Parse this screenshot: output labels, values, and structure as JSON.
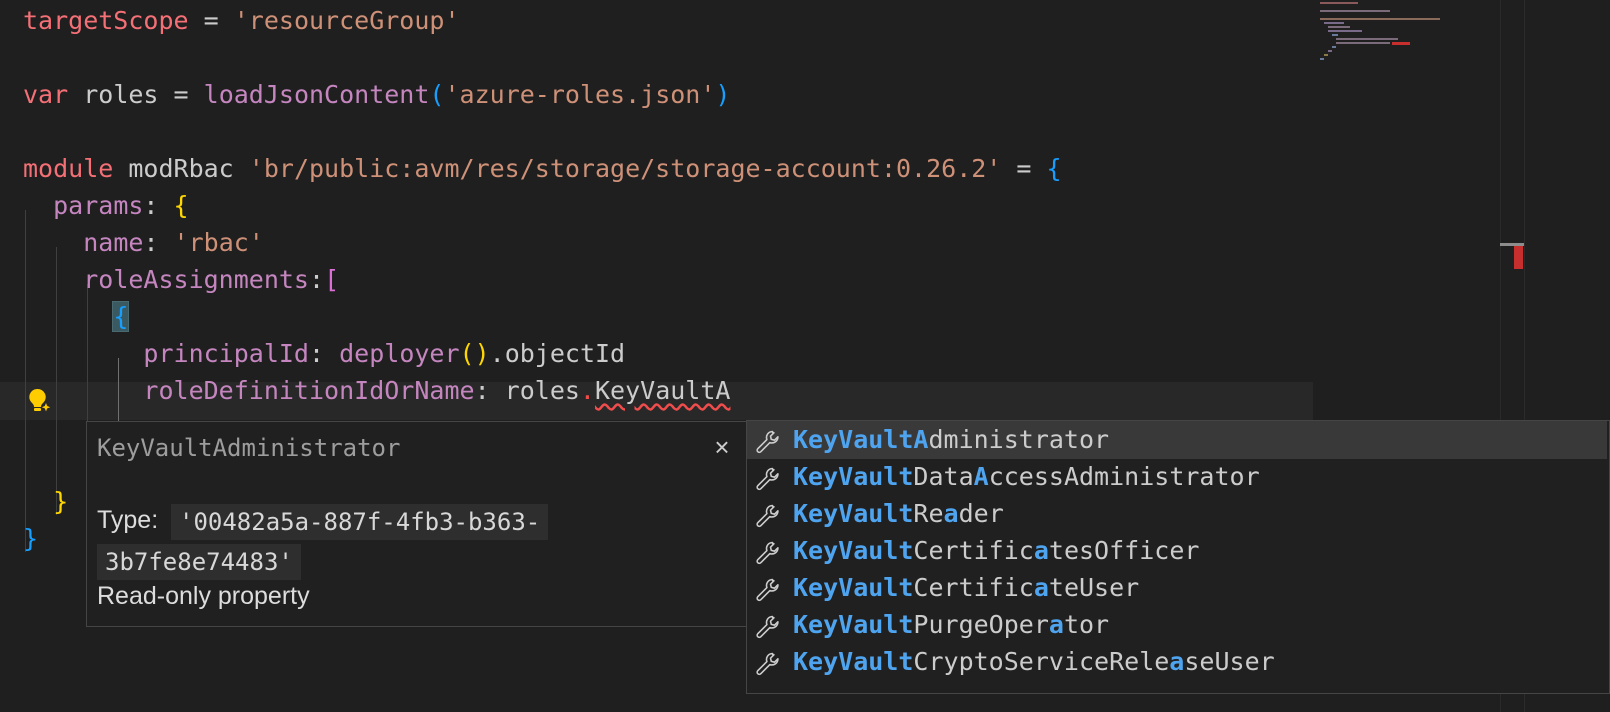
{
  "code_lines": [
    {
      "row": 0,
      "tokens": [
        [
          "kw",
          "targetScope"
        ],
        [
          "punc",
          " = "
        ],
        [
          "str",
          "'resourceGroup'"
        ]
      ]
    },
    {
      "row": 2,
      "tokens": [
        [
          "kw",
          "var"
        ],
        [
          "punc",
          " "
        ],
        [
          "ident",
          "roles"
        ],
        [
          "punc",
          " = "
        ],
        [
          "fn",
          "loadJsonContent"
        ],
        [
          "b3",
          "("
        ],
        [
          "str",
          "'azure-roles.json'"
        ],
        [
          "b3",
          ")"
        ]
      ]
    },
    {
      "row": 4,
      "tokens": [
        [
          "kw",
          "module"
        ],
        [
          "punc",
          " "
        ],
        [
          "ident",
          "modRbac"
        ],
        [
          "punc",
          " "
        ],
        [
          "str",
          "'br/public:avm/res/storage/storage-account:0.26.2'"
        ],
        [
          "punc",
          " = "
        ],
        [
          "b3",
          "{"
        ]
      ]
    },
    {
      "row": 5,
      "tokens": [
        [
          "punc",
          "  "
        ],
        [
          "prop",
          "params"
        ],
        [
          "punc",
          ": "
        ],
        [
          "b1",
          "{"
        ]
      ]
    },
    {
      "row": 6,
      "tokens": [
        [
          "punc",
          "    "
        ],
        [
          "prop",
          "name"
        ],
        [
          "punc",
          ": "
        ],
        [
          "str",
          "'rbac'"
        ]
      ]
    },
    {
      "row": 7,
      "tokens": [
        [
          "punc",
          "    "
        ],
        [
          "prop",
          "roleAssignments"
        ],
        [
          "punc",
          ":"
        ],
        [
          "b2",
          "["
        ]
      ]
    },
    {
      "row": 8,
      "tokens": [
        [
          "punc",
          "      "
        ],
        [
          "b3 brace-hl",
          "{"
        ]
      ]
    },
    {
      "row": 9,
      "tokens": [
        [
          "punc",
          "        "
        ],
        [
          "prop",
          "principalId"
        ],
        [
          "punc",
          ": "
        ],
        [
          "fn",
          "deployer"
        ],
        [
          "b1",
          "()"
        ],
        [
          "punc",
          ".objectId"
        ]
      ]
    },
    {
      "row": 10,
      "tokens": [
        [
          "punc",
          "        "
        ],
        [
          "prop",
          "roleDefinitionIdOrName"
        ],
        [
          "punc",
          ": roles"
        ],
        [
          "dot-err",
          "."
        ],
        [
          "squiggle",
          "KeyVaultA"
        ]
      ]
    },
    {
      "row": 13,
      "tokens": [
        [
          "punc",
          "  "
        ],
        [
          "b1",
          "}"
        ]
      ]
    },
    {
      "row": 14,
      "tokens": [
        [
          "b3",
          "}"
        ]
      ]
    }
  ],
  "hover": {
    "title": "KeyVaultAdministrator",
    "close": "×",
    "type_label": "Type:",
    "type_value_line1": "'00482a5a-887f-4fb3-b363-",
    "type_value_line2": "3b7fe8e74483'",
    "description": "Read-only property"
  },
  "suggestions": [
    {
      "icon": "wrench-icon",
      "parts": [
        [
          "hl",
          "KeyVaultA"
        ],
        [
          "n",
          "dministrator"
        ]
      ],
      "selected": true
    },
    {
      "icon": "wrench-icon",
      "parts": [
        [
          "hl",
          "KeyVault"
        ],
        [
          "n",
          "Data"
        ],
        [
          "hl",
          "A"
        ],
        [
          "n",
          "ccessAdministrator"
        ]
      ]
    },
    {
      "icon": "wrench-icon",
      "parts": [
        [
          "hl",
          "KeyVault"
        ],
        [
          "n",
          "Re"
        ],
        [
          "hl",
          "a"
        ],
        [
          "n",
          "der"
        ]
      ]
    },
    {
      "icon": "wrench-icon",
      "parts": [
        [
          "hl",
          "KeyVault"
        ],
        [
          "n",
          "Certific"
        ],
        [
          "hl",
          "a"
        ],
        [
          "n",
          "tesOfficer"
        ]
      ]
    },
    {
      "icon": "wrench-icon",
      "parts": [
        [
          "hl",
          "KeyVault"
        ],
        [
          "n",
          "Certific"
        ],
        [
          "hl",
          "a"
        ],
        [
          "n",
          "teUser"
        ]
      ]
    },
    {
      "icon": "wrench-icon",
      "parts": [
        [
          "hl",
          "KeyVault"
        ],
        [
          "n",
          "PurgeOper"
        ],
        [
          "hl",
          "a"
        ],
        [
          "n",
          "tor"
        ]
      ]
    },
    {
      "icon": "wrench-icon",
      "parts": [
        [
          "hl",
          "KeyVault"
        ],
        [
          "n",
          "CryptoServiceRele"
        ],
        [
          "hl",
          "a"
        ],
        [
          "n",
          "seUser"
        ]
      ]
    }
  ],
  "colors": {
    "background": "#1f1f1f",
    "keyword": "#f47076",
    "string": "#ce9178",
    "property": "#c586c0",
    "match_highlight": "#4fa4f0",
    "error": "#f14c4c"
  },
  "icons": {
    "lightbulb": "lightbulb-sparkle-icon",
    "suggest_item": "wrench-icon"
  }
}
